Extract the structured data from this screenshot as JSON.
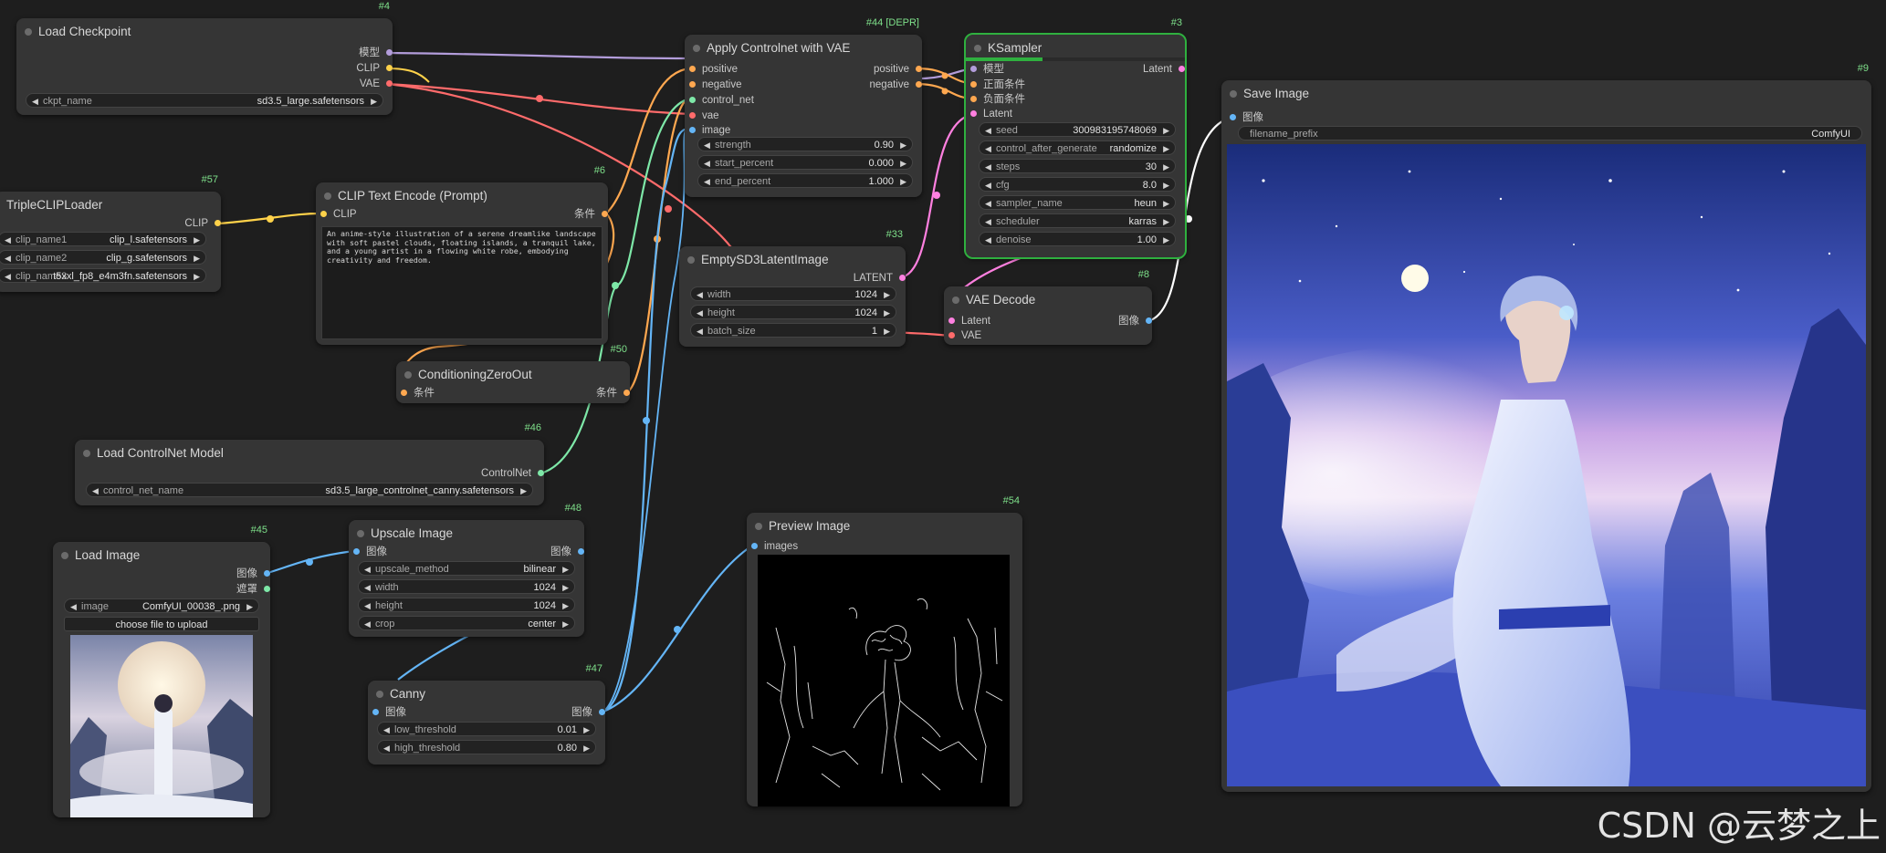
{
  "colors": {
    "model": "#b39ddb",
    "clip": "#ffd24a",
    "vae": "#ff6b6b",
    "conditioning": "#ffa850",
    "control_net": "#7ee8a8",
    "image": "#64b5f6",
    "latent": "#ff80e0",
    "mask": "#7ee8a8",
    "selected": "#2fb03f",
    "node_bg": "#353535",
    "canvas_bg": "#1e1e1e"
  },
  "nodes": {
    "load_checkpoint": {
      "id": "#4",
      "title": "Load Checkpoint",
      "outputs": [
        "模型",
        "CLIP",
        "VAE"
      ],
      "ckpt_name": {
        "label": "ckpt_name",
        "value": "sd3.5_large.safetensors"
      }
    },
    "triple_clip": {
      "id": "#57",
      "title": "TripleCLIPLoader",
      "output": "CLIP",
      "widgets": [
        {
          "label": "clip_name1",
          "value": "clip_l.safetensors"
        },
        {
          "label": "clip_name2",
          "value": "clip_g.safetensors"
        },
        {
          "label": "clip_name3",
          "value": "t5xxl_fp8_e4m3fn.safetensors"
        }
      ]
    },
    "clip_text_encode": {
      "id": "#6",
      "title": "CLIP Text Encode (Prompt)",
      "input": "CLIP",
      "output": "条件",
      "text": "An anime-style illustration of a serene dreamlike landscape with soft pastel clouds, floating islands, a tranquil lake, and a young artist in a flowing white robe, embodying creativity and freedom."
    },
    "conditioning_zero_out": {
      "id": "#50",
      "title": "ConditioningZeroOut",
      "input": "条件",
      "output": "条件"
    },
    "load_controlnet": {
      "id": "#46",
      "title": "Load ControlNet Model",
      "output": "ControlNet",
      "widget": {
        "label": "control_net_name",
        "value": "sd3.5_large_controlnet_canny.safetensors"
      }
    },
    "load_image": {
      "id": "#45",
      "title": "Load Image",
      "outputs": [
        "图像",
        "遮罩"
      ],
      "widget": {
        "label": "image",
        "value": "ComfyUI_00038_.png"
      },
      "upload_label": "choose file to upload"
    },
    "upscale_image": {
      "id": "#48",
      "title": "Upscale Image",
      "input": "图像",
      "output": "图像",
      "widgets": [
        {
          "label": "upscale_method",
          "value": "bilinear"
        },
        {
          "label": "width",
          "value": "1024"
        },
        {
          "label": "height",
          "value": "1024"
        },
        {
          "label": "crop",
          "value": "center"
        }
      ]
    },
    "canny": {
      "id": "#47",
      "title": "Canny",
      "input": "图像",
      "output": "图像",
      "widgets": [
        {
          "label": "low_threshold",
          "value": "0.01"
        },
        {
          "label": "high_threshold",
          "value": "0.80"
        }
      ]
    },
    "apply_controlnet": {
      "id": "#44 [DEPR]",
      "title": "Apply Controlnet with VAE",
      "inputs": [
        "positive",
        "negative",
        "control_net",
        "vae",
        "image"
      ],
      "outputs": [
        "positive",
        "negative"
      ],
      "widgets": [
        {
          "label": "strength",
          "value": "0.90"
        },
        {
          "label": "start_percent",
          "value": "0.000"
        },
        {
          "label": "end_percent",
          "value": "1.000"
        }
      ]
    },
    "empty_latent": {
      "id": "#33",
      "title": "EmptySD3LatentImage",
      "output": "LATENT",
      "widgets": [
        {
          "label": "width",
          "value": "1024"
        },
        {
          "label": "height",
          "value": "1024"
        },
        {
          "label": "batch_size",
          "value": "1"
        }
      ]
    },
    "ksampler": {
      "id": "#3",
      "title": "KSampler",
      "inputs": [
        "模型",
        "正面条件",
        "负面条件",
        "Latent"
      ],
      "output": "Latent",
      "progress": 0.35,
      "widgets": [
        {
          "label": "seed",
          "value": "300983195748069"
        },
        {
          "label": "control_after_generate",
          "value": "randomize"
        },
        {
          "label": "steps",
          "value": "30"
        },
        {
          "label": "cfg",
          "value": "8.0"
        },
        {
          "label": "sampler_name",
          "value": "heun"
        },
        {
          "label": "scheduler",
          "value": "karras"
        },
        {
          "label": "denoise",
          "value": "1.00"
        }
      ]
    },
    "vae_decode": {
      "id": "#8",
      "title": "VAE Decode",
      "inputs": [
        "Latent",
        "VAE"
      ],
      "output": "图像"
    },
    "preview_image": {
      "id": "#54",
      "title": "Preview Image",
      "input": "images"
    },
    "save_image": {
      "id": "#9",
      "title": "Save Image",
      "input": "图像",
      "widget": {
        "label": "filename_prefix",
        "value": "ComfyUI"
      }
    }
  },
  "watermark": "CSDN @云梦之上"
}
